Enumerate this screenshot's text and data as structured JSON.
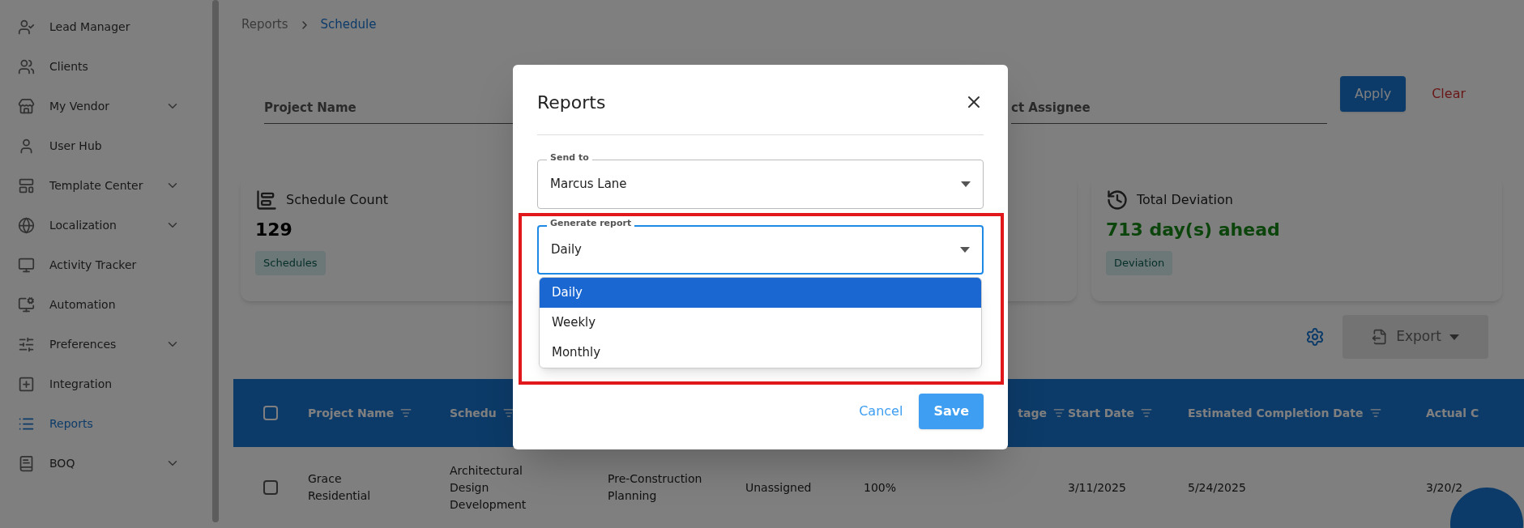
{
  "sidebar": {
    "items": [
      {
        "label": "Lead Manager",
        "expandable": false,
        "selected": false
      },
      {
        "label": "Clients",
        "expandable": false,
        "selected": false
      },
      {
        "label": "My Vendor",
        "expandable": true,
        "selected": false
      },
      {
        "label": "User Hub",
        "expandable": false,
        "selected": false
      },
      {
        "label": "Template Center",
        "expandable": true,
        "selected": false
      },
      {
        "label": "Localization",
        "expandable": true,
        "selected": false
      },
      {
        "label": "Activity Tracker",
        "expandable": false,
        "selected": false
      },
      {
        "label": "Automation",
        "expandable": false,
        "selected": false
      },
      {
        "label": "Preferences",
        "expandable": true,
        "selected": false
      },
      {
        "label": "Integration",
        "expandable": false,
        "selected": false
      },
      {
        "label": "Reports",
        "expandable": false,
        "selected": true
      },
      {
        "label": "BOQ",
        "expandable": true,
        "selected": false
      }
    ]
  },
  "breadcrumb": [
    {
      "label": "Reports",
      "selected": false
    },
    {
      "label": "Schedule",
      "selected": true
    }
  ],
  "filters": {
    "fields": [
      {
        "placeholder": "Project Name"
      },
      {
        "placeholder": "ct Assignee"
      }
    ],
    "buttons": [
      {
        "label": "Apply",
        "kind": "primary"
      },
      {
        "label": "Clear",
        "kind": "text"
      }
    ]
  },
  "cards": [
    {
      "kind": "count",
      "title": "Schedule Count",
      "value": "129",
      "tag": "Schedules"
    },
    {
      "kind": "hidden"
    },
    {
      "kind": "deviation",
      "title": "Total Deviation",
      "value": "713 day(s) ahead",
      "tag": "Deviation"
    }
  ],
  "toolbar": {
    "export_label": "Export",
    "export_disabled": true
  },
  "table": {
    "header_checked": false,
    "columns": [
      {
        "label": "Project Name"
      },
      {
        "label": "Schedu"
      },
      {},
      {},
      {
        "label": "tage"
      },
      {
        "label": "Start Date"
      },
      {
        "label": "Estimated Completion Date"
      },
      {
        "label": "Actual C"
      }
    ],
    "rows": [
      {
        "selected": false,
        "cells": [
          "Grace Residential",
          "Architectural Design Development",
          "Pre-Construction Planning",
          "Unassigned",
          "100%",
          "3/11/2025",
          "5/24/2025",
          "3/20/2"
        ]
      }
    ]
  },
  "dialog": {
    "title": "Reports",
    "highlight": true,
    "fields": [
      {
        "label": "Send to",
        "value": "Marcus Lane",
        "focused": false
      },
      {
        "label": "Generate report",
        "value": "Daily",
        "focused": true,
        "options": [
          {
            "label": "Daily",
            "selected": true
          },
          {
            "label": "Weekly",
            "selected": false
          },
          {
            "label": "Monthly",
            "selected": false
          }
        ]
      }
    ],
    "buttons": [
      {
        "label": "Cancel",
        "kind": "text"
      },
      {
        "label": "Save",
        "kind": "primary"
      }
    ]
  }
}
